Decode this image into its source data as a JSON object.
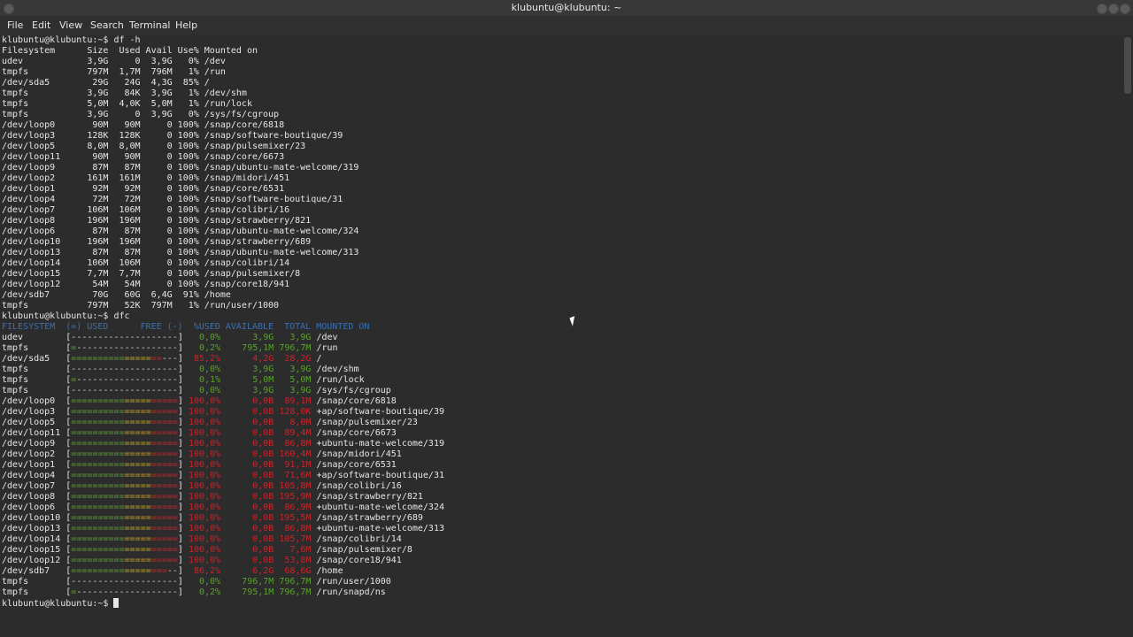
{
  "window": {
    "title": "klubuntu@klubuntu: ~"
  },
  "menu": [
    "File",
    "Edit",
    "View",
    "Search",
    "Terminal",
    "Help"
  ],
  "prompt": "klubuntu@klubuntu:~$ ",
  "commands": {
    "df": "df -h",
    "dfc": "dfc"
  },
  "df_header": "Filesystem      Size  Used Avail Use% Mounted on",
  "df_rows": [
    "udev            3,9G     0  3,9G   0% /dev",
    "tmpfs           797M  1,7M  796M   1% /run",
    "/dev/sda5        29G   24G  4,3G  85% /",
    "tmpfs           3,9G   84K  3,9G   1% /dev/shm",
    "tmpfs           5,0M  4,0K  5,0M   1% /run/lock",
    "tmpfs           3,9G     0  3,9G   0% /sys/fs/cgroup",
    "/dev/loop0       90M   90M     0 100% /snap/core/6818",
    "/dev/loop3      128K  128K     0 100% /snap/software-boutique/39",
    "/dev/loop5      8,0M  8,0M     0 100% /snap/pulsemixer/23",
    "/dev/loop11      90M   90M     0 100% /snap/core/6673",
    "/dev/loop9       87M   87M     0 100% /snap/ubuntu-mate-welcome/319",
    "/dev/loop2      161M  161M     0 100% /snap/midori/451",
    "/dev/loop1       92M   92M     0 100% /snap/core/6531",
    "/dev/loop4       72M   72M     0 100% /snap/software-boutique/31",
    "/dev/loop7      106M  106M     0 100% /snap/colibri/16",
    "/dev/loop8      196M  196M     0 100% /snap/strawberry/821",
    "/dev/loop6       87M   87M     0 100% /snap/ubuntu-mate-welcome/324",
    "/dev/loop10     196M  196M     0 100% /snap/strawberry/689",
    "/dev/loop13      87M   87M     0 100% /snap/ubuntu-mate-welcome/313",
    "/dev/loop14     106M  106M     0 100% /snap/colibri/14",
    "/dev/loop15     7,7M  7,7M     0 100% /snap/pulsemixer/8",
    "/dev/loop12      54M   54M     0 100% /snap/core18/941",
    "/dev/sdb7        70G   60G  6,4G  91% /home",
    "tmpfs           797M   52K  797M   1% /run/user/1000"
  ],
  "dfc_header": "FILESYSTEM  (=) USED      FREE (-)  %USED AVAILABLE  TOTAL MOUNTED ON",
  "dfc_rows": [
    {
      "fs": "udev",
      "bar": "--------------------",
      "used": 0,
      "pct": "0,0%",
      "avail": "3,9G",
      "total": "3,9G",
      "mnt": "/dev"
    },
    {
      "fs": "tmpfs",
      "bar": "=-------------------",
      "used": 1,
      "pct": "0,2%",
      "avail": "795,1M",
      "total": "796,7M",
      "mnt": "/run"
    },
    {
      "fs": "/dev/sda5",
      "bar": "=================---",
      "used": 17,
      "pct": "85,2%",
      "avail": "4,2G",
      "total": "28,2G",
      "mnt": "/"
    },
    {
      "fs": "tmpfs",
      "bar": "--------------------",
      "used": 0,
      "pct": "0,0%",
      "avail": "3,9G",
      "total": "3,9G",
      "mnt": "/dev/shm"
    },
    {
      "fs": "tmpfs",
      "bar": "=-------------------",
      "used": 1,
      "pct": "0,1%",
      "avail": "5,0M",
      "total": "5,0M",
      "mnt": "/run/lock"
    },
    {
      "fs": "tmpfs",
      "bar": "--------------------",
      "used": 0,
      "pct": "0,0%",
      "avail": "3,9G",
      "total": "3,9G",
      "mnt": "/sys/fs/cgroup"
    },
    {
      "fs": "/dev/loop0",
      "bar": "====================",
      "used": 20,
      "pct": "100,0%",
      "avail": "0,0B",
      "total": "89,1M",
      "mnt": "/snap/core/6818"
    },
    {
      "fs": "/dev/loop3",
      "bar": "====================",
      "used": 20,
      "pct": "100,0%",
      "avail": "0,0B",
      "total": "128,0K",
      "mnt": "+ap/software-boutique/39"
    },
    {
      "fs": "/dev/loop5",
      "bar": "====================",
      "used": 20,
      "pct": "100,0%",
      "avail": "0,0B",
      "total": "8,0M",
      "mnt": "/snap/pulsemixer/23"
    },
    {
      "fs": "/dev/loop11",
      "bar": "====================",
      "used": 20,
      "pct": "100,0%",
      "avail": "0,0B",
      "total": "89,4M",
      "mnt": "/snap/core/6673"
    },
    {
      "fs": "/dev/loop9",
      "bar": "====================",
      "used": 20,
      "pct": "100,0%",
      "avail": "0,0B",
      "total": "86,8M",
      "mnt": "+ubuntu-mate-welcome/319"
    },
    {
      "fs": "/dev/loop2",
      "bar": "====================",
      "used": 20,
      "pct": "100,0%",
      "avail": "0,0B",
      "total": "160,4M",
      "mnt": "/snap/midori/451"
    },
    {
      "fs": "/dev/loop1",
      "bar": "====================",
      "used": 20,
      "pct": "100,0%",
      "avail": "0,0B",
      "total": "91,1M",
      "mnt": "/snap/core/6531"
    },
    {
      "fs": "/dev/loop4",
      "bar": "====================",
      "used": 20,
      "pct": "100,0%",
      "avail": "0,0B",
      "total": "71,6M",
      "mnt": "+ap/software-boutique/31"
    },
    {
      "fs": "/dev/loop7",
      "bar": "====================",
      "used": 20,
      "pct": "100,0%",
      "avail": "0,0B",
      "total": "105,8M",
      "mnt": "/snap/colibri/16"
    },
    {
      "fs": "/dev/loop8",
      "bar": "====================",
      "used": 20,
      "pct": "100,0%",
      "avail": "0,0B",
      "total": "195,9M",
      "mnt": "/snap/strawberry/821"
    },
    {
      "fs": "/dev/loop6",
      "bar": "====================",
      "used": 20,
      "pct": "100,0%",
      "avail": "0,0B",
      "total": "86,9M",
      "mnt": "+ubuntu-mate-welcome/324"
    },
    {
      "fs": "/dev/loop10",
      "bar": "====================",
      "used": 20,
      "pct": "100,0%",
      "avail": "0,0B",
      "total": "195,5M",
      "mnt": "/snap/strawberry/689"
    },
    {
      "fs": "/dev/loop13",
      "bar": "====================",
      "used": 20,
      "pct": "100,0%",
      "avail": "0,0B",
      "total": "86,8M",
      "mnt": "+ubuntu-mate-welcome/313"
    },
    {
      "fs": "/dev/loop14",
      "bar": "====================",
      "used": 20,
      "pct": "100,0%",
      "avail": "0,0B",
      "total": "105,7M",
      "mnt": "/snap/colibri/14"
    },
    {
      "fs": "/dev/loop15",
      "bar": "====================",
      "used": 20,
      "pct": "100,0%",
      "avail": "0,0B",
      "total": "7,6M",
      "mnt": "/snap/pulsemixer/8"
    },
    {
      "fs": "/dev/loop12",
      "bar": "====================",
      "used": 20,
      "pct": "100,0%",
      "avail": "0,0B",
      "total": "53,8M",
      "mnt": "/snap/core18/941"
    },
    {
      "fs": "/dev/sdb7",
      "bar": "==================--",
      "used": 18,
      "pct": "86,2%",
      "avail": "6,2G",
      "total": "68,6G",
      "mnt": "/home"
    },
    {
      "fs": "tmpfs",
      "bar": "--------------------",
      "used": 0,
      "pct": "0,0%",
      "avail": "796,7M",
      "total": "796,7M",
      "mnt": "/run/user/1000"
    },
    {
      "fs": "tmpfs",
      "bar": "=-------------------",
      "used": 1,
      "pct": "0,2%",
      "avail": "795,1M",
      "total": "796,7M",
      "mnt": "/run/snapd/ns"
    }
  ],
  "colors": {
    "background": "#2c2c2c",
    "text": "#e6e6e6",
    "header": "#3c6fb0",
    "green": "#5aa02c",
    "yellow": "#c8a317",
    "red": "#c7242b"
  }
}
